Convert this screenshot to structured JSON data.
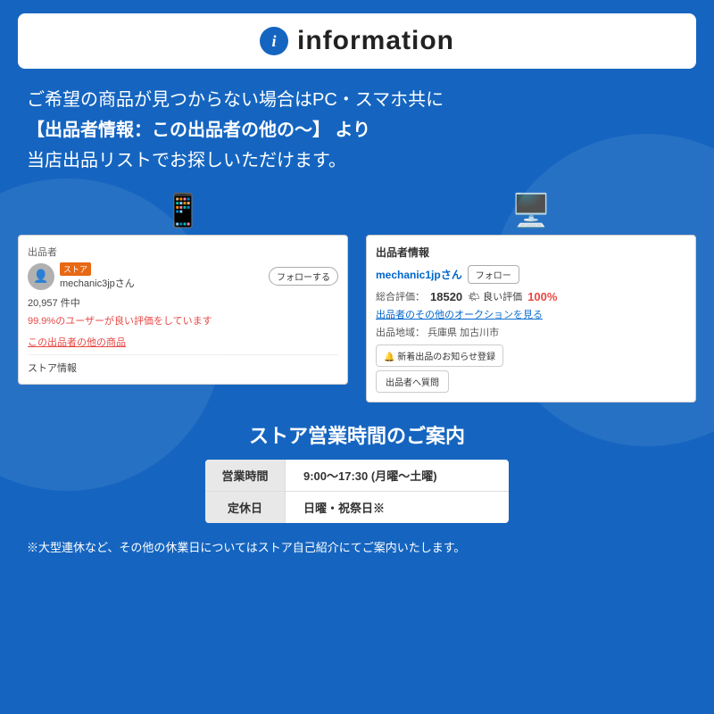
{
  "header": {
    "title": "information",
    "icon_label": "i"
  },
  "description": {
    "line1": "ご希望の商品が見つからない場合はPC・スマホ共に",
    "line2": "【出品者情報：この出品者の他の〜】 より",
    "line3": "当店出品リストでお探しいただけます。"
  },
  "mobile_screenshot": {
    "section_label": "出品者",
    "store_badge": "ストア",
    "seller_name": "mechanic3jpさん",
    "follow_button": "フォローする",
    "stats": "20,957 件中",
    "positive_rate": "99.9%のユーザーが良い評価をしています",
    "other_items_link": "この出品者の他の商品",
    "store_info": "ストア情報"
  },
  "pc_screenshot": {
    "section_title": "出品者情報",
    "seller_name": "mechanic1jpさん",
    "follow_button": "フォロー",
    "rating_label": "総合評価：",
    "rating_num": "18520",
    "good_label": "🌤 良い評価",
    "good_pct": "100%",
    "auction_link": "出品者のその他のオークションを見る",
    "location_label": "出品地域：",
    "location": "兵庫県 加古川市",
    "notify_button": "🔔 新着出品のお知らせ登録",
    "question_button": "出品者へ質問"
  },
  "hours_section": {
    "title": "ストア営業時間のご案内",
    "rows": [
      {
        "label": "営業時間",
        "value": "9:00〜17:30 (月曜〜土曜)"
      },
      {
        "label": "定休日",
        "value": "日曜・祝祭日※"
      }
    ],
    "notice": "※大型連休など、その他の休業日についてはストア自己紹介にてご案内いたします。"
  },
  "colors": {
    "background": "#1565c0",
    "white": "#ffffff",
    "accent_red": "#e53935",
    "accent_blue": "#0066cc",
    "orange": "#e65c00"
  }
}
